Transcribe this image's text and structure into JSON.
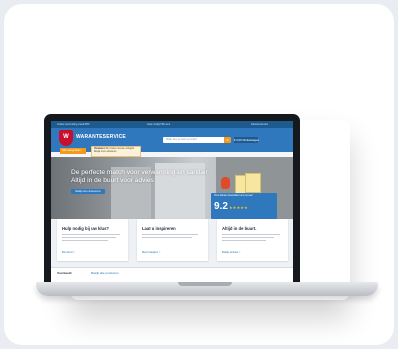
{
  "site": {
    "topbar": {
      "left": "Gratis verzending vanaf €50",
      "mid": "Hulp nodig? Bel ons",
      "right": "Klantenservice"
    },
    "logo_text": "WARANTESERVICE",
    "search_placeholder": "Waar ben je naar op zoek?",
    "search_icon": "search-icon",
    "cart_label": "€ 0,00  Winkelwagen",
    "menu_label": "Alle categorieën",
    "notice": {
      "title": "Vacatures",
      "text": "Wij zoeken nieuwe collega's. Bekijk onze vacatures."
    },
    "sub_links": "Showroom · Advies · Inspiratie · Contact",
    "hero": {
      "line1": "De perfecte match voor verwarming en sanitair",
      "line2": "Altijd in de buurt voor advies",
      "button": "Bekijk onze showrooms"
    },
    "rating": {
      "label": "Onze klanten beoordelen ons met een",
      "score": "9.2",
      "stars": "★★★★★"
    },
    "cards": [
      {
        "title": "Hulp nodig bij uw klus?",
        "link": "Bel direct  >"
      },
      {
        "title": "Laat u inspireren",
        "link": "Meer bekijken  >"
      },
      {
        "title": "Altijd in de buurt.",
        "link": "Bekijk winkels  >"
      }
    ],
    "footer": {
      "left": "Voorbeeld",
      "right": "Bekijk alle producten"
    }
  },
  "colors": {
    "brand_blue": "#2f78bd",
    "accent_orange": "#f39a1e",
    "logo_red": "#c8102e"
  }
}
